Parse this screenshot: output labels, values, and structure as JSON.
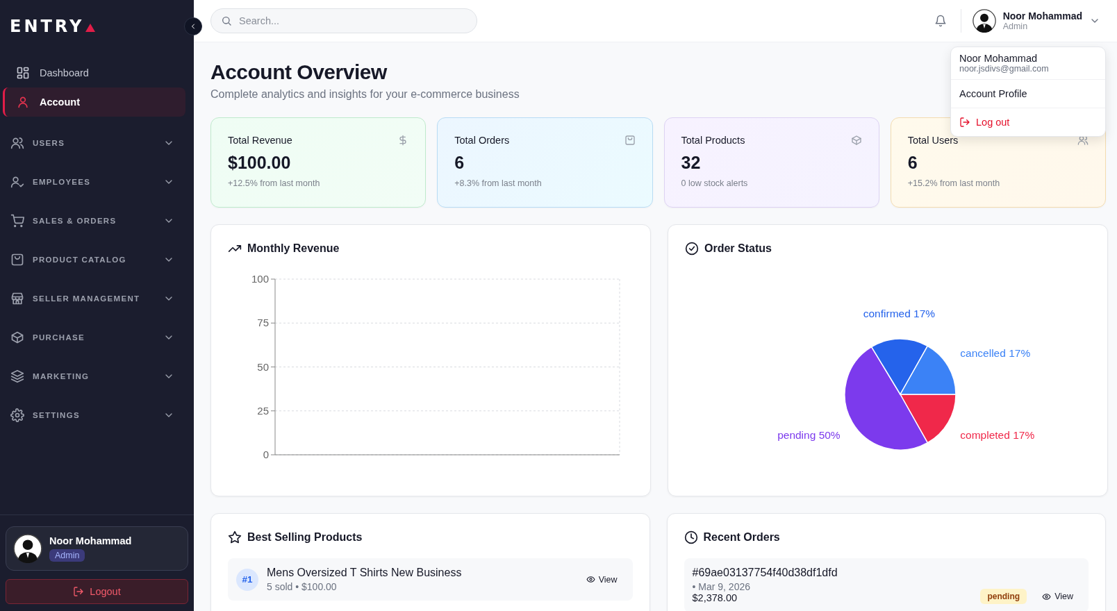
{
  "sidebar": {
    "logo": "ENTRY",
    "items": [
      {
        "kind": "link",
        "label": "Dashboard",
        "selected": false
      },
      {
        "kind": "link",
        "label": "Account",
        "selected": true
      },
      {
        "kind": "group",
        "label": "USERS",
        "expanded": false
      },
      {
        "kind": "group",
        "label": "EMPLOYEES",
        "expanded": false
      },
      {
        "kind": "group",
        "label": "SALES & ORDERS",
        "expanded": false
      },
      {
        "kind": "group",
        "label": "PRODUCT CATALOG",
        "expanded": false
      },
      {
        "kind": "group",
        "label": "SELLER MANAGEMENT",
        "expanded": false
      },
      {
        "kind": "group",
        "label": "PURCHASE",
        "expanded": false
      },
      {
        "kind": "group",
        "label": "MARKETING",
        "expanded": false
      },
      {
        "kind": "group",
        "label": "SETTINGS",
        "expanded": false
      }
    ],
    "user": {
      "name": "Noor Mohammad",
      "role": "Admin"
    },
    "logout": "Logout"
  },
  "header": {
    "search": {
      "placeholder": "Search..."
    },
    "user": {
      "name": "Noor Mohammad",
      "role": "Admin",
      "menu_open": true
    },
    "menu": {
      "name": "Noor Mohammad",
      "email": "noor.jsdivs@gmail.com",
      "items": [
        {
          "kind": "plain",
          "label": "Account Profile"
        },
        {
          "kind": "danger",
          "label": "Log out"
        }
      ]
    }
  },
  "page": {
    "title": "Account Overview",
    "subtitle": "Complete analytics and insights for your e-commerce business"
  },
  "stats": [
    {
      "title": "Total Revenue",
      "value": "$100.00",
      "note": "+12.5% from last month"
    },
    {
      "title": "Total Orders",
      "value": "6",
      "note": "+8.3% from last month"
    },
    {
      "title": "Total Products",
      "value": "32",
      "note": "0 low stock alerts"
    },
    {
      "title": "Total Users",
      "value": "6",
      "note": "+15.2% from last month"
    }
  ],
  "monthly_revenue": {
    "title": "Monthly Revenue",
    "axis_labels": [
      "100",
      "75",
      "50",
      "25",
      "0"
    ]
  },
  "order_status": {
    "title": "Order Status",
    "chart_data": {
      "type": "pie",
      "categories": [
        "completed",
        "pending",
        "confirmed",
        "cancelled"
      ],
      "values": [
        17,
        50,
        17,
        17
      ],
      "colors": [
        "#f0284a",
        "#7c3aed",
        "#2563eb",
        "#3b82f6"
      ],
      "value_labels": [
        "17%",
        "50%",
        "17%",
        "17%"
      ]
    }
  },
  "best_selling": {
    "title": "Best Selling Products",
    "items": [
      {
        "rank": "#1",
        "name": "Mens Oversized T Shirts New Business",
        "meta": "5 sold • $100.00",
        "action": "View"
      }
    ]
  },
  "recent_orders": {
    "title": "Recent Orders",
    "items": [
      {
        "id": "#69ae03137754f40d38df1dfd",
        "date": "• Mar 9, 2026",
        "total": "$2,378.00",
        "status": "pending",
        "action": "View"
      }
    ]
  }
}
